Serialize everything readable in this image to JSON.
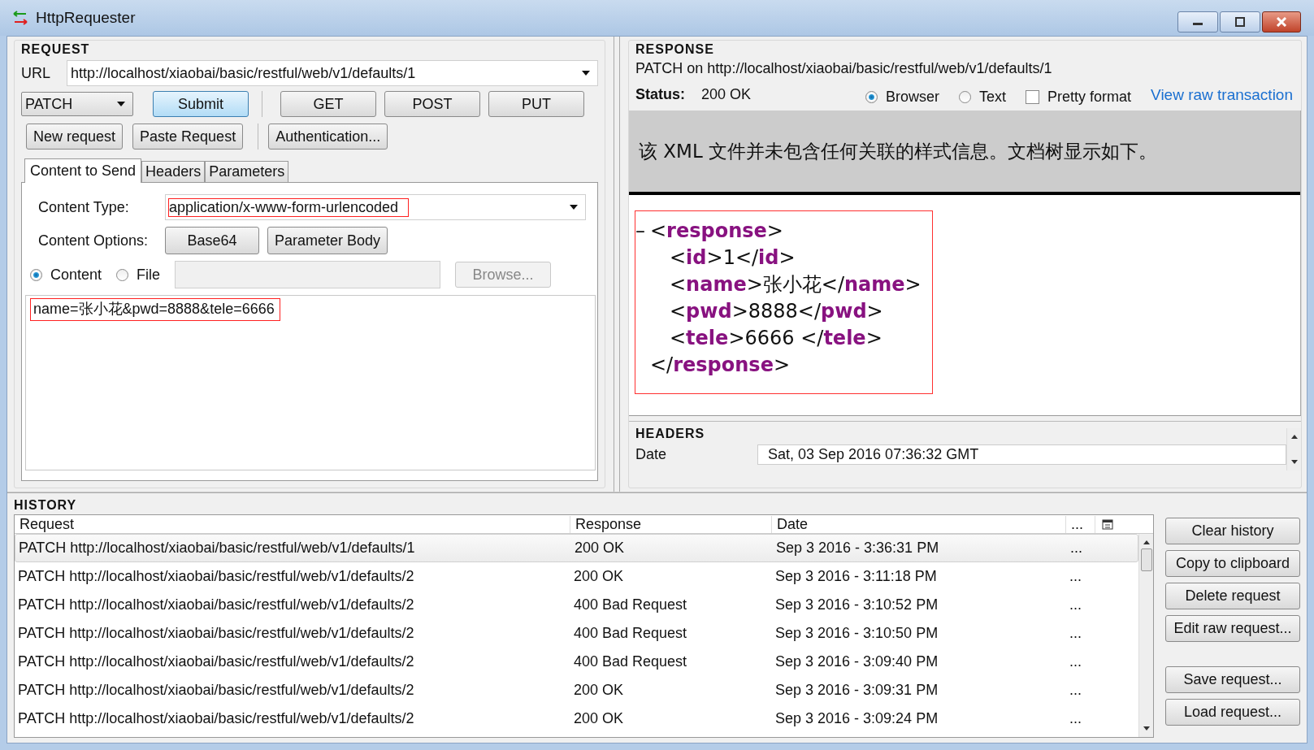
{
  "window": {
    "title": "HttpRequester"
  },
  "request": {
    "heading": "REQUEST",
    "url_label": "URL",
    "url": "http://localhost/xiaobai/basic/restful/web/v1/defaults/1",
    "method": "PATCH",
    "buttons_row1": [
      {
        "label": "Submit",
        "kind": "default"
      },
      {
        "label": "GET",
        "kind": "plain"
      },
      {
        "label": "POST",
        "kind": "plain"
      },
      {
        "label": "PUT",
        "kind": "plain"
      }
    ],
    "buttons_row2": [
      {
        "label": "New request"
      },
      {
        "label": "Paste Request"
      },
      {
        "label": "Authentication..."
      }
    ],
    "tabs": [
      {
        "label": "Content to Send",
        "selected": true
      },
      {
        "label": "Headers",
        "selected": false
      },
      {
        "label": "Parameters",
        "selected": false
      }
    ],
    "content_type_label": "Content Type:",
    "content_type": "application/x-www-form-urlencoded",
    "content_type_highlighted": true,
    "content_options_label": "Content Options:",
    "content_options": [
      "Base64",
      "Parameter Body"
    ],
    "sources": [
      {
        "label": "Content",
        "selected": true
      },
      {
        "label": "File",
        "selected": false
      }
    ],
    "browse": {
      "label": "Browse...",
      "disabled": true
    },
    "body": "name=张小花&pwd=8888&tele=6666",
    "body_highlighted": true
  },
  "response": {
    "heading": "RESPONSE",
    "summary": "PATCH on http://localhost/xiaobai/basic/restful/web/v1/defaults/1",
    "status_label": "Status:",
    "status": "200 OK",
    "views": [
      {
        "label": "Browser",
        "selected": true
      },
      {
        "label": "Text",
        "selected": false
      }
    ],
    "pretty_format": {
      "label": "Pretty format",
      "checked": false
    },
    "raw_link": "View raw transaction",
    "notice": "该 XML 文件并未包含任何关联的样式信息。文档树显示如下。",
    "xml_highlighted": true,
    "xml": {
      "toggle": "–",
      "open": "<**response**>",
      "close": "</**response**>",
      "children": [
        {
          "line": "<**id**>1</**id**>"
        },
        {
          "line": "<**name**>张小花</**name**>"
        },
        {
          "line": "<**pwd**>8888</**pwd**>"
        },
        {
          "line": "<**tele**>6666 </**tele**>"
        }
      ]
    },
    "headers_heading": "HEADERS",
    "headers": [
      {
        "name": "Date",
        "value": "Sat, 03 Sep 2016 07:36:32 GMT"
      }
    ]
  },
  "history": {
    "heading": "HISTORY",
    "columns": [
      "Request",
      "Response",
      "Date",
      "..."
    ],
    "rows": [
      {
        "cells": [
          "PATCH http://localhost/xiaobai/basic/restful/web/v1/defaults/1",
          "200 OK",
          "Sep 3 2016 - 3:36:31 PM",
          "..."
        ],
        "selected": true
      },
      {
        "cells": [
          "PATCH http://localhost/xiaobai/basic/restful/web/v1/defaults/2",
          "200 OK",
          "Sep 3 2016 - 3:11:18 PM",
          "..."
        ],
        "selected": false
      },
      {
        "cells": [
          "PATCH http://localhost/xiaobai/basic/restful/web/v1/defaults/2",
          "400 Bad Request",
          "Sep 3 2016 - 3:10:52 PM",
          "..."
        ],
        "selected": false
      },
      {
        "cells": [
          "PATCH http://localhost/xiaobai/basic/restful/web/v1/defaults/2",
          "400 Bad Request",
          "Sep 3 2016 - 3:10:50 PM",
          "..."
        ],
        "selected": false
      },
      {
        "cells": [
          "PATCH http://localhost/xiaobai/basic/restful/web/v1/defaults/2",
          "400 Bad Request",
          "Sep 3 2016 - 3:09:40 PM",
          "..."
        ],
        "selected": false
      },
      {
        "cells": [
          "PATCH http://localhost/xiaobai/basic/restful/web/v1/defaults/2",
          "200 OK",
          "Sep 3 2016 - 3:09:31 PM",
          "..."
        ],
        "selected": false
      },
      {
        "cells": [
          "PATCH http://localhost/xiaobai/basic/restful/web/v1/defaults/2",
          "200 OK",
          "Sep 3 2016 - 3:09:24 PM",
          "..."
        ],
        "selected": false
      }
    ],
    "action_groups": [
      [
        "Clear history",
        "Copy to clipboard",
        "Delete request",
        "Edit raw request..."
      ],
      [
        "Save request...",
        "Load request..."
      ]
    ]
  }
}
